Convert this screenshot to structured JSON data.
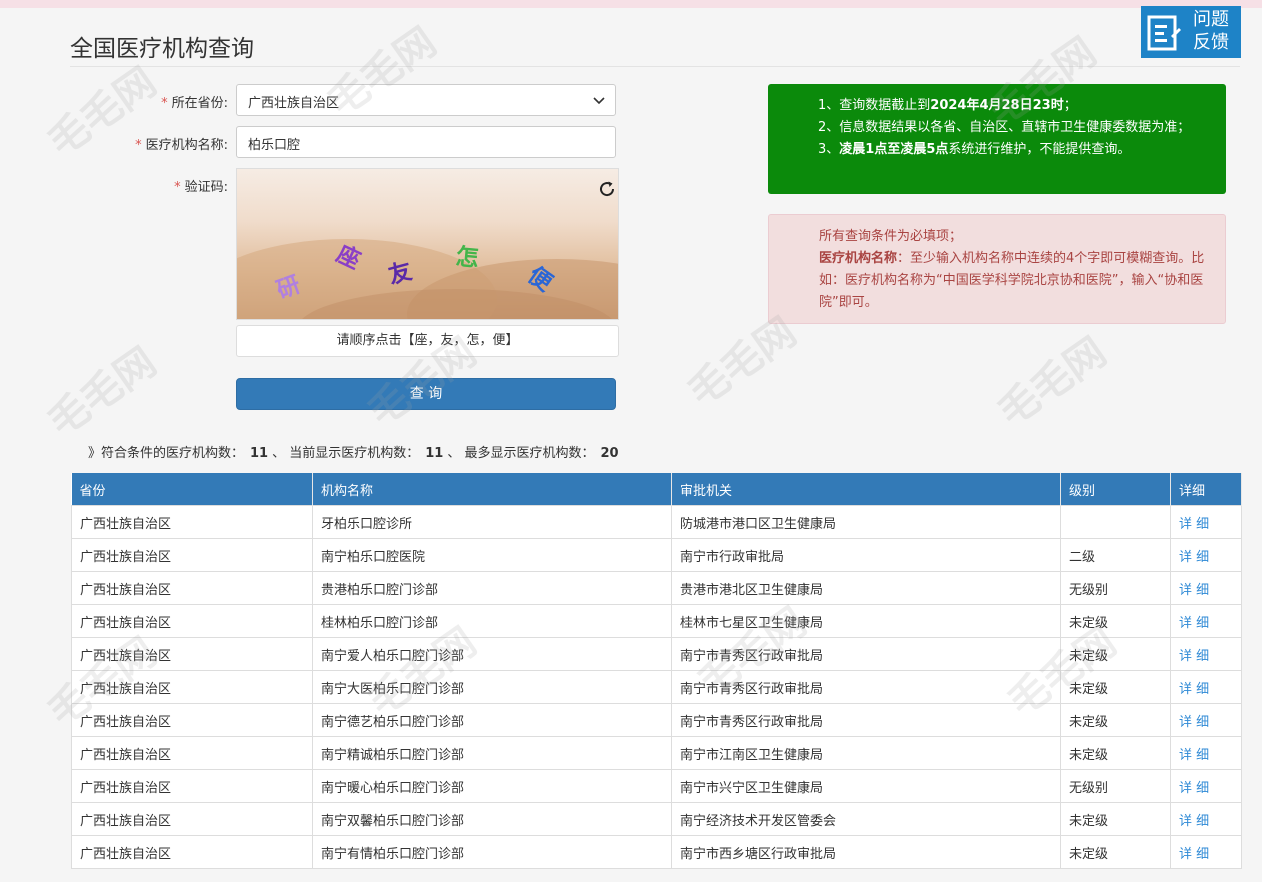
{
  "page": {
    "title": "全国医疗机构查询"
  },
  "feedback": {
    "label": "问题反馈"
  },
  "form": {
    "province_label": "所在省份:",
    "province_value": "广西壮族自治区",
    "name_label": "医疗机构名称:",
    "name_value": "柏乐口腔",
    "captcha_label": "验证码:",
    "captcha_chars": [
      "研",
      "座",
      "友",
      "怎",
      "便"
    ],
    "captcha_prompt": "请顺序点击【座，友，怎，便】",
    "submit_label": "查 询"
  },
  "notices": {
    "green": {
      "line1_prefix": "1、查询数据截止到",
      "line1_bold": "2024年4月28日23时",
      "line1_suffix": "；",
      "line2": "2、信息数据结果以各省、自治区、直辖市卫生健康委数据为准；",
      "line3_prefix": "3、",
      "line3_bold": "凌晨1点至凌晨5点",
      "line3_suffix": "系统进行维护，不能提供查询。"
    },
    "pink": {
      "line1": "所有查询条件为必填项；",
      "line2_bold": "医疗机构名称",
      "line2_text": "：至少输入机构名称中连续的4个字即可模糊查询。比如：医疗机构名称为“中国医学科学院北京协和医院”，输入“协和医院”即可。"
    }
  },
  "summary": {
    "prefix": "》符合条件的医疗机构数：",
    "matched": "11",
    "mid": "、 当前显示医疗机构数：",
    "shown": "11",
    "mid2": "、 最多显示医疗机构数：",
    "max": "20"
  },
  "table": {
    "headers": [
      "省份",
      "机构名称",
      "审批机关",
      "级别",
      "详细"
    ],
    "rows": [
      {
        "province": "广西壮族自治区",
        "name": "牙柏乐口腔诊所",
        "authority": "防城港市港口区卫生健康局",
        "level": "",
        "detail": "详 细"
      },
      {
        "province": "广西壮族自治区",
        "name": "南宁柏乐口腔医院",
        "authority": "南宁市行政审批局",
        "level": "二级",
        "detail": "详 细"
      },
      {
        "province": "广西壮族自治区",
        "name": "贵港柏乐口腔门诊部",
        "authority": "贵港市港北区卫生健康局",
        "level": "无级别",
        "detail": "详 细"
      },
      {
        "province": "广西壮族自治区",
        "name": "桂林柏乐口腔门诊部",
        "authority": "桂林市七星区卫生健康局",
        "level": "未定级",
        "detail": "详 细"
      },
      {
        "province": "广西壮族自治区",
        "name": "南宁爱人柏乐口腔门诊部",
        "authority": "南宁市青秀区行政审批局",
        "level": "未定级",
        "detail": "详 细"
      },
      {
        "province": "广西壮族自治区",
        "name": "南宁大医柏乐口腔门诊部",
        "authority": "南宁市青秀区行政审批局",
        "level": "未定级",
        "detail": "详 细"
      },
      {
        "province": "广西壮族自治区",
        "name": "南宁德艺柏乐口腔门诊部",
        "authority": "南宁市青秀区行政审批局",
        "level": "未定级",
        "detail": "详 细"
      },
      {
        "province": "广西壮族自治区",
        "name": "南宁精诚柏乐口腔门诊部",
        "authority": "南宁市江南区卫生健康局",
        "level": "未定级",
        "detail": "详 细"
      },
      {
        "province": "广西壮族自治区",
        "name": "南宁暖心柏乐口腔门诊部",
        "authority": "南宁市兴宁区卫生健康局",
        "level": "无级别",
        "detail": "详 细"
      },
      {
        "province": "广西壮族自治区",
        "name": "南宁双馨柏乐口腔门诊部",
        "authority": "南宁经济技术开发区管委会",
        "level": "未定级",
        "detail": "详 细"
      },
      {
        "province": "广西壮族自治区",
        "name": "南宁有情柏乐口腔门诊部",
        "authority": "南宁市西乡塘区行政审批局",
        "level": "未定级",
        "detail": "详 细"
      }
    ]
  },
  "watermark": {
    "text": "毛毛网"
  }
}
